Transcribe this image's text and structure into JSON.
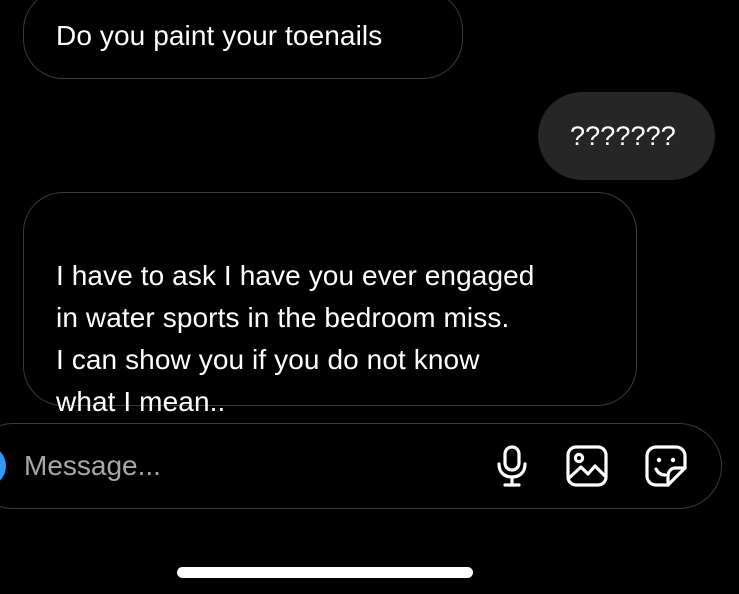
{
  "messages": [
    {
      "direction": "incoming",
      "text": "Do you paint your toenails"
    },
    {
      "direction": "outgoing",
      "text": "???????"
    },
    {
      "direction": "incoming",
      "text": "I have to ask I have you ever engaged\nin water sports in the bedroom miss.\nI can show you if you do not know\nwhat I mean.."
    }
  ],
  "composer": {
    "placeholder": "Message...",
    "value": "",
    "icons": [
      "microphone-icon",
      "gallery-icon",
      "sticker-icon"
    ],
    "accent_color": "#3797f0"
  },
  "colors": {
    "background": "#000000",
    "outgoing_bubble": "#262626",
    "incoming_border": "#3a3a3c",
    "text": "#ffffff",
    "placeholder": "#a8a8a8"
  }
}
